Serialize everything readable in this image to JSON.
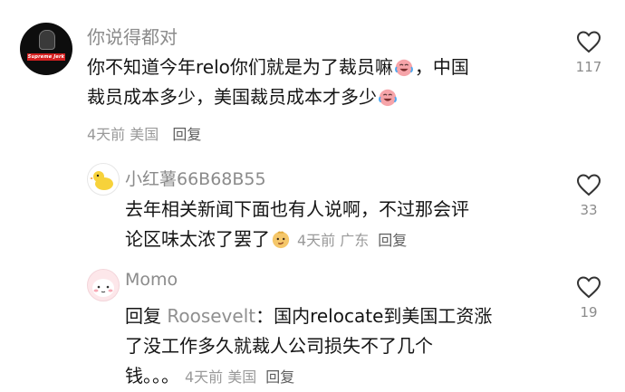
{
  "comments": [
    {
      "username": "你说得都对",
      "avatar_text": "Supreme Jerk",
      "text_line1": "你不知道今年relo你们就是为了裁员嘛",
      "text_line1_end": "，中国",
      "text_line2": "裁员成本多少，美国裁员成本才多少",
      "time": "4天前",
      "location": "美国",
      "reply_label": "回复",
      "likes": "117",
      "emoji": "laugh-cry"
    },
    {
      "username": "小红薯66B68B55",
      "text_line1": "去年相关新闻下面也有人说啊，不过那会评",
      "text_line2": "论区味太浓了罢了",
      "time": "4天前",
      "location": "广东",
      "reply_label": "回复",
      "likes": "33",
      "emoji": "smirk"
    },
    {
      "username": "Momo",
      "reply_prefix": "回复",
      "reply_to": "Roosevelt",
      "text_line1": "：国内relocate到美国工资涨",
      "text_line2": "了没工作多久就裁人公司损失不了几个",
      "text_line3": "钱。。。",
      "time": "4天前",
      "location": "美国",
      "reply_label": "回复",
      "likes": "19"
    }
  ],
  "icons": {
    "like": "heart-outline-icon"
  },
  "colors": {
    "text": "#151515",
    "meta": "#9a9a9a",
    "username": "#8b8b8b",
    "reply_link": "#5e5e5e"
  }
}
